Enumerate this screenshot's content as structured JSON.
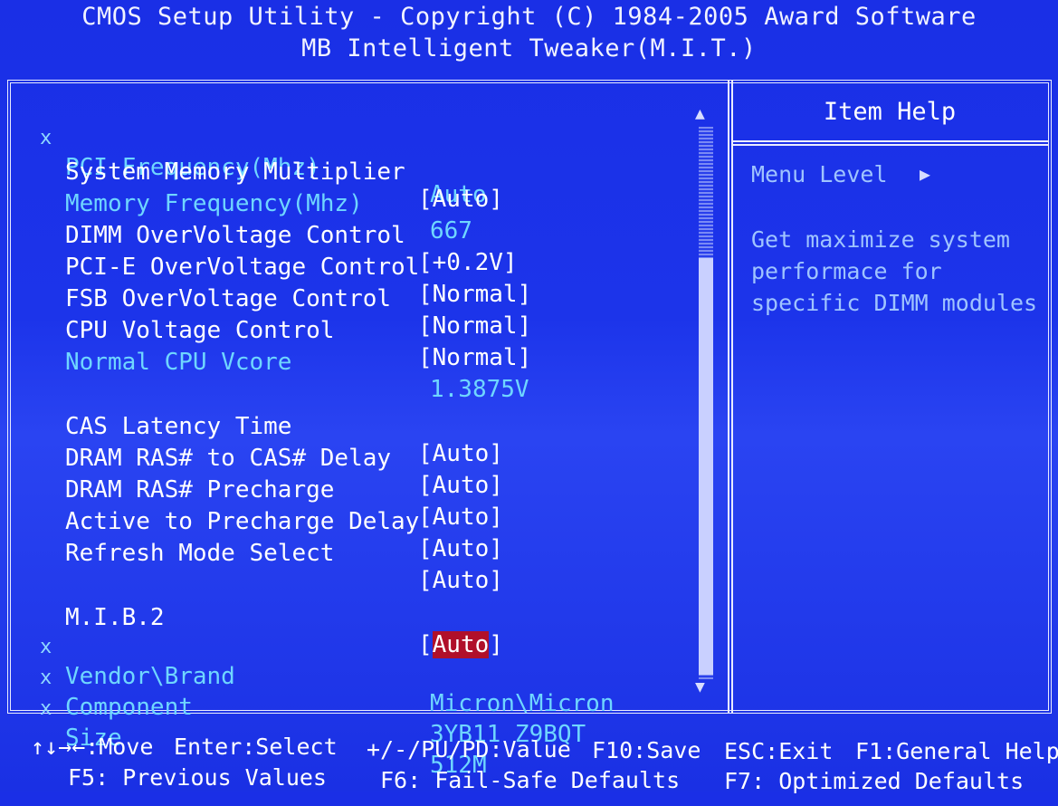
{
  "header": {
    "title": "CMOS Setup Utility - Copyright (C) 1984-2005 Award Software",
    "subtitle": "MB Intelligent Tweaker(M.I.T.)"
  },
  "items": [
    {
      "mark": "x",
      "label": "PCI Frequency(Mhz)",
      "value": "Auto",
      "state": "dim"
    },
    {
      "mark": "",
      "label": "System Memory Multiplier",
      "value": "[Auto]",
      "state": "normal"
    },
    {
      "mark": "",
      "label": "Memory Frequency(Mhz)",
      "value": "667",
      "state": "dim"
    },
    {
      "mark": "",
      "label": "DIMM OverVoltage Control",
      "value": "[+0.2V]",
      "state": "normal"
    },
    {
      "mark": "",
      "label": "PCI-E OverVoltage Control",
      "value": "[Normal]",
      "state": "normal"
    },
    {
      "mark": "",
      "label": "FSB OverVoltage Control",
      "value": "[Normal]",
      "state": "normal"
    },
    {
      "mark": "",
      "label": "CPU Voltage Control",
      "value": "[Normal]",
      "state": "normal"
    },
    {
      "mark": "",
      "label": "Normal CPU Vcore",
      "value": "1.3875V",
      "state": "dim"
    },
    {
      "mark": "",
      "label": "CAS Latency Time",
      "value": "[Auto]",
      "state": "normal"
    },
    {
      "mark": "",
      "label": "DRAM RAS# to CAS# Delay",
      "value": "[Auto]",
      "state": "normal"
    },
    {
      "mark": "",
      "label": "DRAM RAS# Precharge",
      "value": "[Auto]",
      "state": "normal"
    },
    {
      "mark": "",
      "label": "Active to Precharge Delay",
      "value": "[Auto]",
      "state": "normal"
    },
    {
      "mark": "",
      "label": "Refresh Mode Select",
      "value": "[Auto]",
      "state": "normal"
    },
    {
      "mark": "",
      "label": "M.I.B.2",
      "value": "Auto",
      "state": "selected"
    },
    {
      "mark": "x",
      "label": "Vendor\\Brand",
      "value": "Micron\\Micron",
      "state": "dim"
    },
    {
      "mark": "x",
      "label": "Component",
      "value": "3YB11 Z9BQT",
      "state": "dim"
    },
    {
      "mark": "x",
      "label": "Size",
      "value": "512M",
      "state": "dim"
    }
  ],
  "help": {
    "title": "Item Help",
    "menu_level": "Menu Level",
    "description_lines": [
      "Get maximize system",
      "performace for",
      "specific DIMM modules"
    ]
  },
  "footer": {
    "move": "↑↓→←:Move",
    "enter": "Enter:Select",
    "value": "+/-/PU/PD:Value",
    "save": "F10:Save",
    "exit": "ESC:Exit",
    "help": "F1:General Help",
    "prev": "F5: Previous Values",
    "failsafe": "F6: Fail-Safe Defaults",
    "optimized": "F7: Optimized Defaults"
  },
  "colors": {
    "background": "#1c34ea",
    "active_text": "#ffffff",
    "inactive_text": "#6fd6ff",
    "highlight": "#b0102a"
  },
  "icons": {
    "menu_arrow": "right-triangle-icon",
    "scroll_up": "up-triangle-icon",
    "scroll_down": "down-triangle-icon"
  }
}
